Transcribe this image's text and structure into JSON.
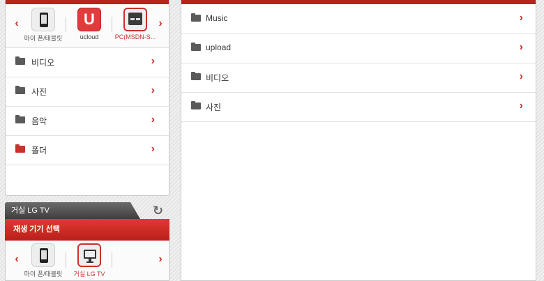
{
  "source_devices": {
    "prev_label": "‹",
    "next_label": "›",
    "items": [
      {
        "label": "마이 폰/태블릿",
        "icon": "phone-icon"
      },
      {
        "label": "ucloud",
        "icon": "ucloud-icon",
        "glyph": "U"
      },
      {
        "label": "PC(MSDN-S...",
        "icon": "pc-server-icon",
        "selected": true
      }
    ]
  },
  "left_list": [
    {
      "label": "비디오"
    },
    {
      "label": "사진"
    },
    {
      "label": "음악"
    },
    {
      "label": "폴더",
      "selected": true
    }
  ],
  "player": {
    "tab_title": "거실 LG TV",
    "header": "재생 기기 선택",
    "prev_label": "‹",
    "next_label": "›",
    "devices": [
      {
        "label": "마이 폰/태블릿",
        "icon": "phone-icon"
      },
      {
        "label": "거실 LG TV",
        "icon": "tv-icon",
        "selected": true
      }
    ]
  },
  "right_list": [
    {
      "label": "Music"
    },
    {
      "label": "upload"
    },
    {
      "label": "비디오"
    },
    {
      "label": "사진"
    }
  ],
  "chevron": "›",
  "refresh_glyph": "↻",
  "colors": {
    "accent": "#c8322b",
    "header_red": "#b9231d",
    "dark_tab": "#4a4a4a"
  }
}
